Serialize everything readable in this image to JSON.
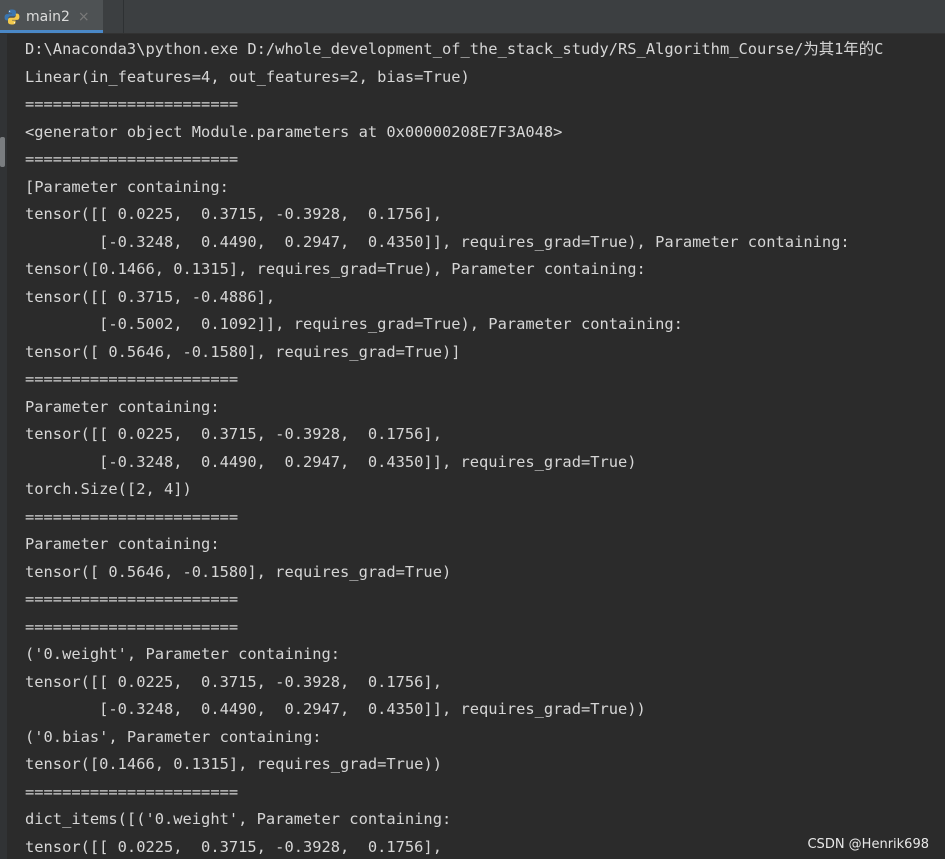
{
  "tab": {
    "title": "main2",
    "close_glyph": "×",
    "icon": "python-icon"
  },
  "console": {
    "lines": [
      "D:\\Anaconda3\\python.exe D:/whole_development_of_the_stack_study/RS_Algorithm_Course/为其1年的C",
      "Linear(in_features=4, out_features=2, bias=True)",
      "=======================",
      "<generator object Module.parameters at 0x00000208E7F3A048>",
      "=======================",
      "[Parameter containing:",
      "tensor([[ 0.0225,  0.3715, -0.3928,  0.1756],",
      "        [-0.3248,  0.4490,  0.2947,  0.4350]], requires_grad=True), Parameter containing:",
      "tensor([0.1466, 0.1315], requires_grad=True), Parameter containing:",
      "tensor([[ 0.3715, -0.4886],",
      "        [-0.5002,  0.1092]], requires_grad=True), Parameter containing:",
      "tensor([ 0.5646, -0.1580], requires_grad=True)]",
      "=======================",
      "Parameter containing:",
      "tensor([[ 0.0225,  0.3715, -0.3928,  0.1756],",
      "        [-0.3248,  0.4490,  0.2947,  0.4350]], requires_grad=True)",
      "torch.Size([2, 4])",
      "=======================",
      "Parameter containing:",
      "tensor([ 0.5646, -0.1580], requires_grad=True)",
      "=======================",
      "=======================",
      "('0.weight', Parameter containing:",
      "tensor([[ 0.0225,  0.3715, -0.3928,  0.1756],",
      "        [-0.3248,  0.4490,  0.2947,  0.4350]], requires_grad=True))",
      "('0.bias', Parameter containing:",
      "tensor([0.1466, 0.1315], requires_grad=True))",
      "=======================",
      "dict_items([('0.weight', Parameter containing:",
      "tensor([[ 0.0225,  0.3715, -0.3928,  0.1756],"
    ]
  },
  "watermark": "CSDN @Henrik698",
  "colors": {
    "background": "#2b2b2b",
    "text": "#d6d6d6",
    "tab_active": "#4e5254",
    "tab_underline": "#4a88c7",
    "python_blue": "#3b76b0",
    "python_yellow": "#f2c94c"
  }
}
